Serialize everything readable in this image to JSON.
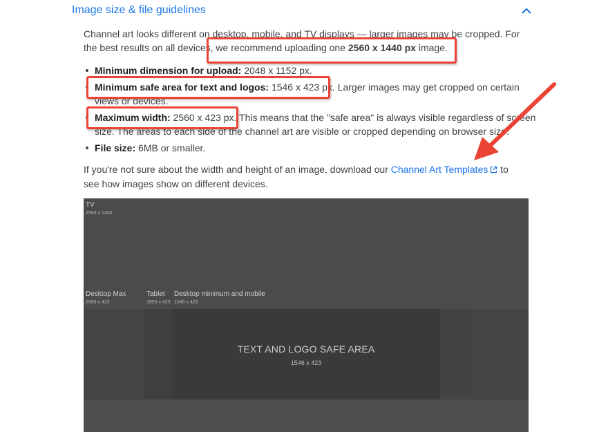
{
  "section": {
    "title": "Image size & file guidelines"
  },
  "intro": {
    "part1": "Channel art looks different on desktop, mobile, and TV displays — larger images may be cropped. For the best results on all devices,",
    "part2": " we recommend uploading one ",
    "bold": "2560 x 1440 px",
    "part3": " image."
  },
  "bullets": [
    {
      "label": "Minimum dimension for upload:",
      "value": " 2048 x 1152 px."
    },
    {
      "label": "Minimum safe area for text and logos:",
      "value": " 1546 x 423 px.",
      "rest": " Larger images may get cropped on certain views or devices."
    },
    {
      "label": "Maximum width:",
      "value": " 2560 x 423 px.",
      "rest": " This means that the \"safe area\" is always visible regardless of screen size. The areas to each side of the channel art are visible or cropped depending on browser size."
    },
    {
      "label": "File size:",
      "value": " 6MB or smaller."
    }
  ],
  "help": {
    "before": "If you're not sure about the width and height of an image, download our ",
    "link": "Channel Art Templates",
    "after": " to see how images show on different devices."
  },
  "diagram": {
    "tv_label": "TV",
    "tv_dims": "2560 x 1440",
    "desktop_max_label": "Desktop Max",
    "desktop_max_dims": "2560 x 423",
    "tablet_label": "Tablet",
    "tablet_dims": "1855 x 423",
    "desktop_min_label": "Desktop minimum and mobile",
    "desktop_min_dims": "1546 x 423",
    "safe_title": "TEXT AND LOGO SAFE AREA",
    "safe_dims": "1546 x 423"
  },
  "colors": {
    "link": "#1a73e8",
    "highlight": "#ea4335"
  },
  "icons": {
    "collapse": "chevron-up-icon",
    "external": "external-link-icon",
    "arrow": "annotation-arrow-icon"
  }
}
